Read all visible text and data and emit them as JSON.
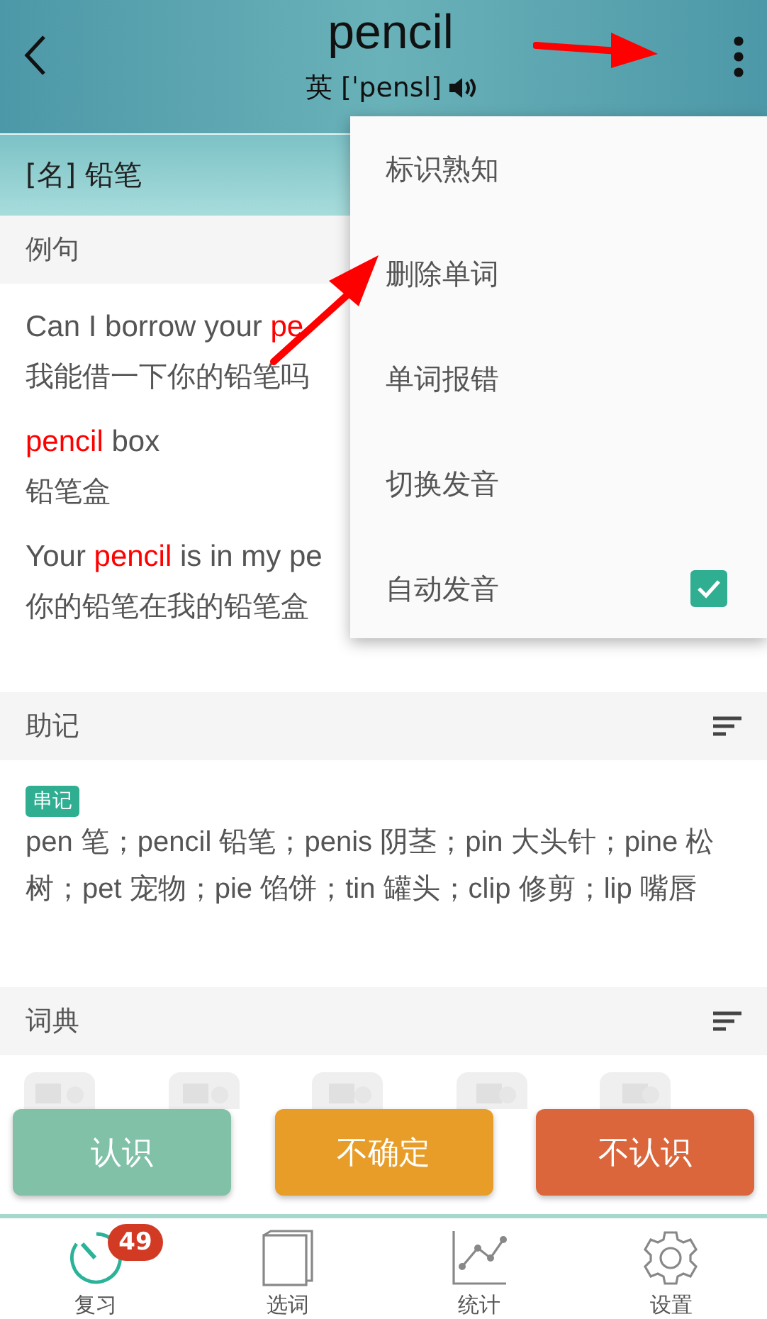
{
  "header": {
    "word": "pencil",
    "phonetic": "英 [ˈpensl]"
  },
  "definition": "[名] 铅笔",
  "examples_section": {
    "title": "例句",
    "examples": [
      {
        "en": [
          {
            "text": "Can I borrow your ",
            "highlight": false
          },
          {
            "text": "pe",
            "highlight": true
          }
        ],
        "zh": "我能借一下你的铅笔吗"
      },
      {
        "en": [
          {
            "text": "pencil",
            "highlight": true
          },
          {
            "text": " box",
            "highlight": false
          }
        ],
        "zh": "铅笔盒"
      },
      {
        "en": [
          {
            "text": "Your ",
            "highlight": false
          },
          {
            "text": "pencil",
            "highlight": true
          },
          {
            "text": " is in my pe",
            "highlight": false
          }
        ],
        "zh": "你的铅笔在我的铅笔盒"
      }
    ]
  },
  "mnemonic_section": {
    "title": "助记",
    "tag": "串记",
    "text": "pen 笔；pencil 铅笔；penis 阴茎；pin 大头针；pine 松树；pet 宠物；pie 馅饼；tin 罐头；clip 修剪；lip 嘴唇"
  },
  "dictionary_section": {
    "title": "词典"
  },
  "menu": [
    {
      "label": "标识熟知",
      "kind": "plain"
    },
    {
      "label": "删除单词",
      "kind": "plain"
    },
    {
      "label": "单词报错",
      "kind": "plain"
    },
    {
      "label": "切换发音",
      "kind": "plain"
    },
    {
      "label": "自动发音",
      "kind": "checkbox",
      "checked": true
    }
  ],
  "answer_buttons": [
    {
      "label": "认识",
      "color": "#80c1a8"
    },
    {
      "label": "不确定",
      "color": "#e89d28"
    },
    {
      "label": "不认识",
      "color": "#dc663c"
    }
  ],
  "tabs": [
    {
      "label": "复习",
      "selected": true,
      "badge": "49"
    },
    {
      "label": "选词",
      "selected": false
    },
    {
      "label": "统计",
      "selected": false
    },
    {
      "label": "设置",
      "selected": false
    }
  ],
  "annotations": [
    {
      "kind": "arrow"
    },
    {
      "kind": "arrow"
    }
  ]
}
